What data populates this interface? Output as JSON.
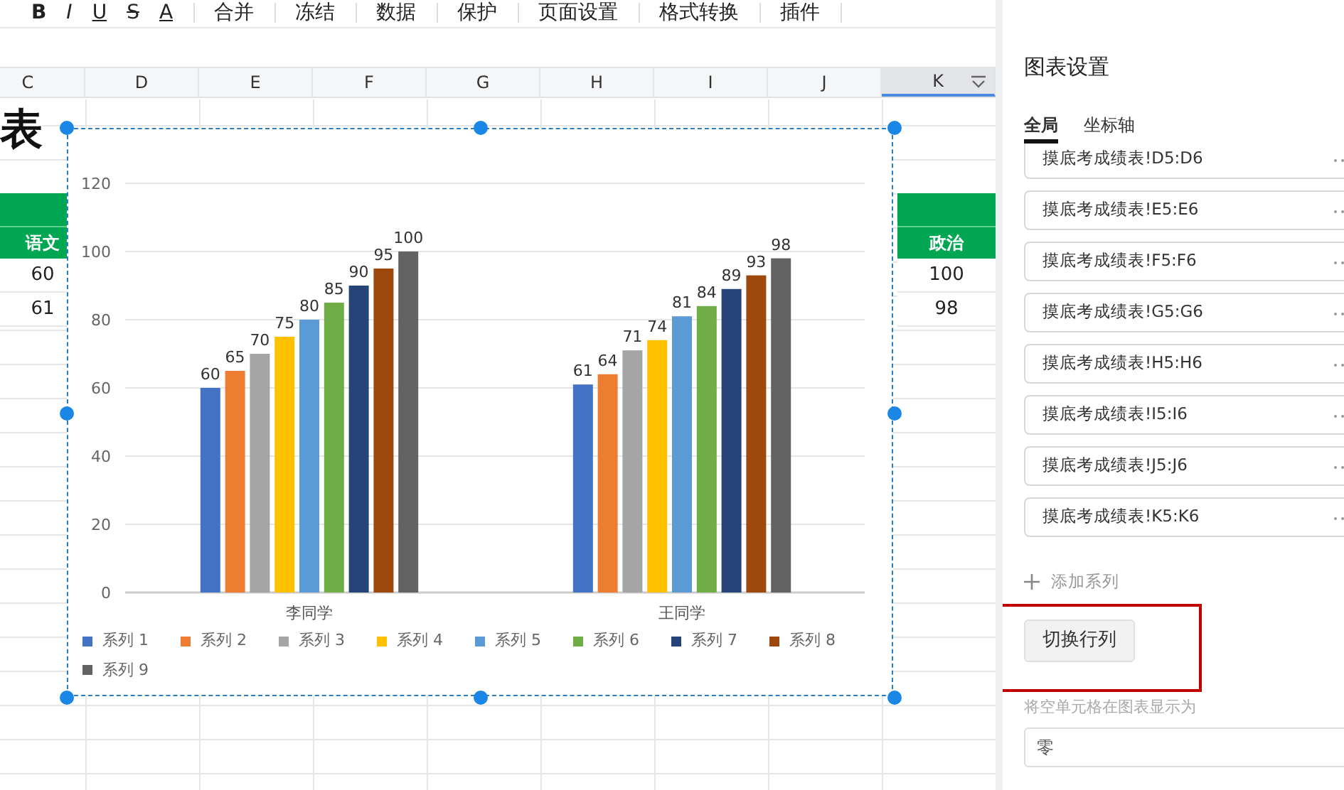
{
  "toolbar": {
    "format_buttons": [
      "B",
      "I",
      "U",
      "S",
      "A"
    ],
    "items": [
      "合并",
      "冻结",
      "数据",
      "保护",
      "页面设置",
      "格式转换",
      "插件"
    ]
  },
  "sheet": {
    "columns": [
      {
        "label": "C",
        "selected": false
      },
      {
        "label": "D",
        "selected": false
      },
      {
        "label": "E",
        "selected": false
      },
      {
        "label": "F",
        "selected": false
      },
      {
        "label": "G",
        "selected": false
      },
      {
        "label": "H",
        "selected": false
      },
      {
        "label": "I",
        "selected": false
      },
      {
        "label": "J",
        "selected": false
      },
      {
        "label": "K",
        "selected": true
      }
    ],
    "title": "表",
    "left_table": {
      "header": "语文",
      "values": [
        "60",
        "61"
      ]
    },
    "right_table": {
      "header": "政治",
      "values": [
        "100",
        "98"
      ]
    }
  },
  "chart": {
    "chart_data": {
      "type": "bar",
      "categories": [
        "李同学",
        "王同学"
      ],
      "ylim": [
        0,
        120
      ],
      "yticks": [
        0,
        20,
        40,
        60,
        80,
        100,
        120
      ],
      "data_labels": true,
      "grid": true,
      "legend": true,
      "series": [
        {
          "name": "系列 1",
          "color": "#4472c4",
          "values": [
            60,
            61
          ]
        },
        {
          "name": "系列 2",
          "color": "#ed7d31",
          "values": [
            65,
            64
          ]
        },
        {
          "name": "系列 3",
          "color": "#a5a5a5",
          "values": [
            70,
            71
          ]
        },
        {
          "name": "系列 4",
          "color": "#ffc000",
          "values": [
            75,
            74
          ]
        },
        {
          "name": "系列 5",
          "color": "#5b9bd5",
          "values": [
            80,
            81
          ]
        },
        {
          "name": "系列 6",
          "color": "#70ad47",
          "values": [
            85,
            84
          ]
        },
        {
          "name": "系列 7",
          "color": "#264478",
          "values": [
            90,
            89
          ]
        },
        {
          "name": "系列 8",
          "color": "#9e480e",
          "values": [
            95,
            93
          ]
        },
        {
          "name": "系列 9",
          "color": "#636363",
          "values": [
            100,
            98
          ]
        }
      ]
    }
  },
  "panel": {
    "title": "图表设置",
    "tabs": [
      {
        "label": "全局",
        "selected": true
      },
      {
        "label": "坐标轴",
        "selected": false
      }
    ],
    "series_ranges": [
      "摸底考成绩表!D5:D6",
      "摸底考成绩表!E5:E6",
      "摸底考成绩表!F5:F6",
      "摸底考成绩表!G5:G6",
      "摸底考成绩表!H5:H6",
      "摸底考成绩表!I5:I6",
      "摸底考成绩表!J5:J6",
      "摸底考成绩表!K5:K6"
    ],
    "add_series": "添加系列",
    "switch_button": {
      "label": "切换行列",
      "highlighted": true
    },
    "empty_cells_label": "将空单元格在图表显示为",
    "empty_cells_value": "零"
  }
}
